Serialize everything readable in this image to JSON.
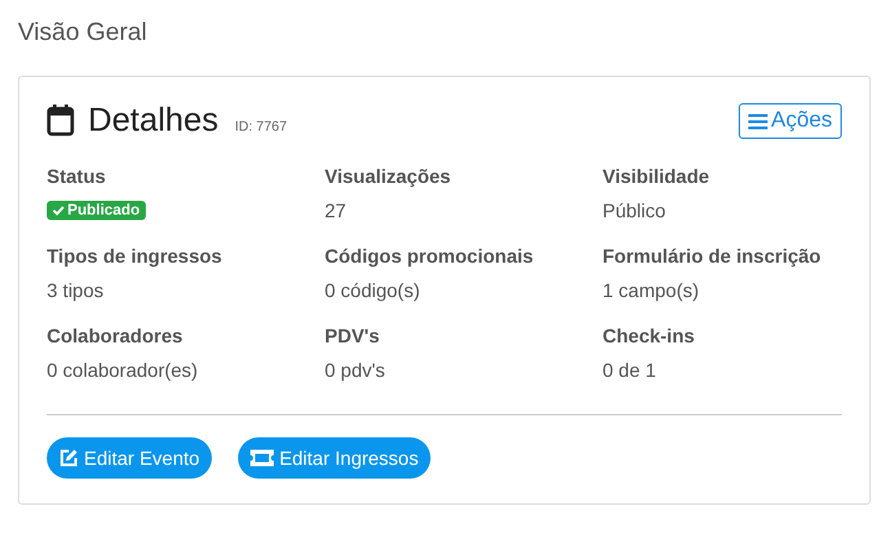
{
  "page_title": "Visão Geral",
  "card": {
    "title": "Detalhes",
    "id_label": "ID: 7767",
    "actions_button": "Ações",
    "fields": [
      {
        "label": "Status",
        "kind": "badge",
        "value": "Publicado"
      },
      {
        "label": "Visualizações",
        "kind": "text",
        "value": "27"
      },
      {
        "label": "Visibilidade",
        "kind": "text",
        "value": "Público"
      },
      {
        "label": "Tipos de ingressos",
        "kind": "text",
        "value": "3 tipos"
      },
      {
        "label": "Códigos promocionais",
        "kind": "text",
        "value": "0 código(s)"
      },
      {
        "label": "Formulário de inscrição",
        "kind": "text",
        "value": "1 campo(s)"
      },
      {
        "label": "Colaboradores",
        "kind": "text",
        "value": "0 colaborador(es)"
      },
      {
        "label": "PDV's",
        "kind": "text",
        "value": "0 pdv's"
      },
      {
        "label": "Check-ins",
        "kind": "text",
        "value": "0 de 1"
      }
    ],
    "buttons": [
      {
        "label": "Editar Evento",
        "kind": "edit"
      },
      {
        "label": "Editar Ingressos",
        "kind": "ticket"
      }
    ]
  }
}
